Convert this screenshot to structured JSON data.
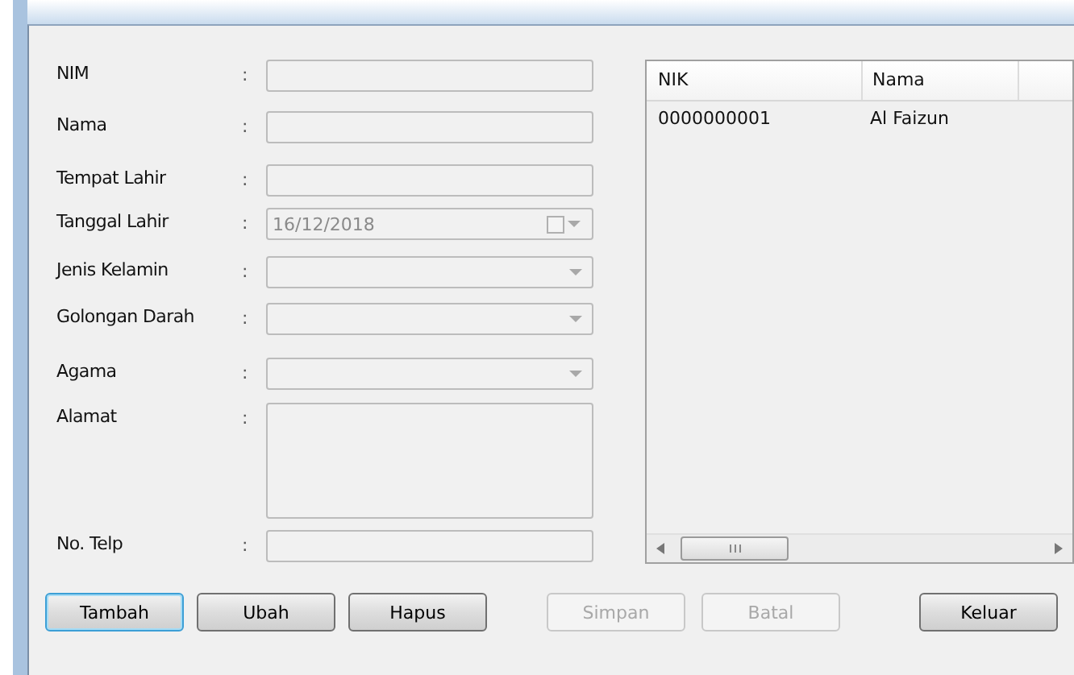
{
  "form": {
    "fields": [
      {
        "label": "NIM",
        "kind": "text",
        "disabled": true
      },
      {
        "label": "Nama",
        "kind": "text",
        "disabled": true
      },
      {
        "label": "Tempat Lahir",
        "kind": "text",
        "disabled": true
      },
      {
        "label": "Tanggal Lahir",
        "kind": "date",
        "value": "16/12/2018",
        "disabled": true
      },
      {
        "label": "Jenis Kelamin",
        "kind": "combo",
        "disabled": true
      },
      {
        "label": "Golongan Darah",
        "kind": "combo",
        "disabled": true
      },
      {
        "label": "Agama",
        "kind": "combo",
        "disabled": true
      },
      {
        "label": "Alamat",
        "kind": "memo",
        "disabled": true
      },
      {
        "label": "No. Telp",
        "kind": "text",
        "disabled": true
      }
    ],
    "separator": ":"
  },
  "table": {
    "columns": [
      "NIK",
      "Nama"
    ],
    "rows": [
      [
        "0000000001",
        "Al Faizun"
      ]
    ]
  },
  "buttons": [
    {
      "label": "Tambah",
      "disabled": false,
      "focused": true
    },
    {
      "label": "Ubah",
      "disabled": false,
      "focused": false
    },
    {
      "label": "Hapus",
      "disabled": false,
      "focused": false
    },
    {
      "label": "Simpan",
      "disabled": true,
      "focused": false
    },
    {
      "label": "Batal",
      "disabled": true,
      "focused": false
    },
    {
      "label": "Keluar",
      "disabled": false,
      "focused": false
    }
  ]
}
